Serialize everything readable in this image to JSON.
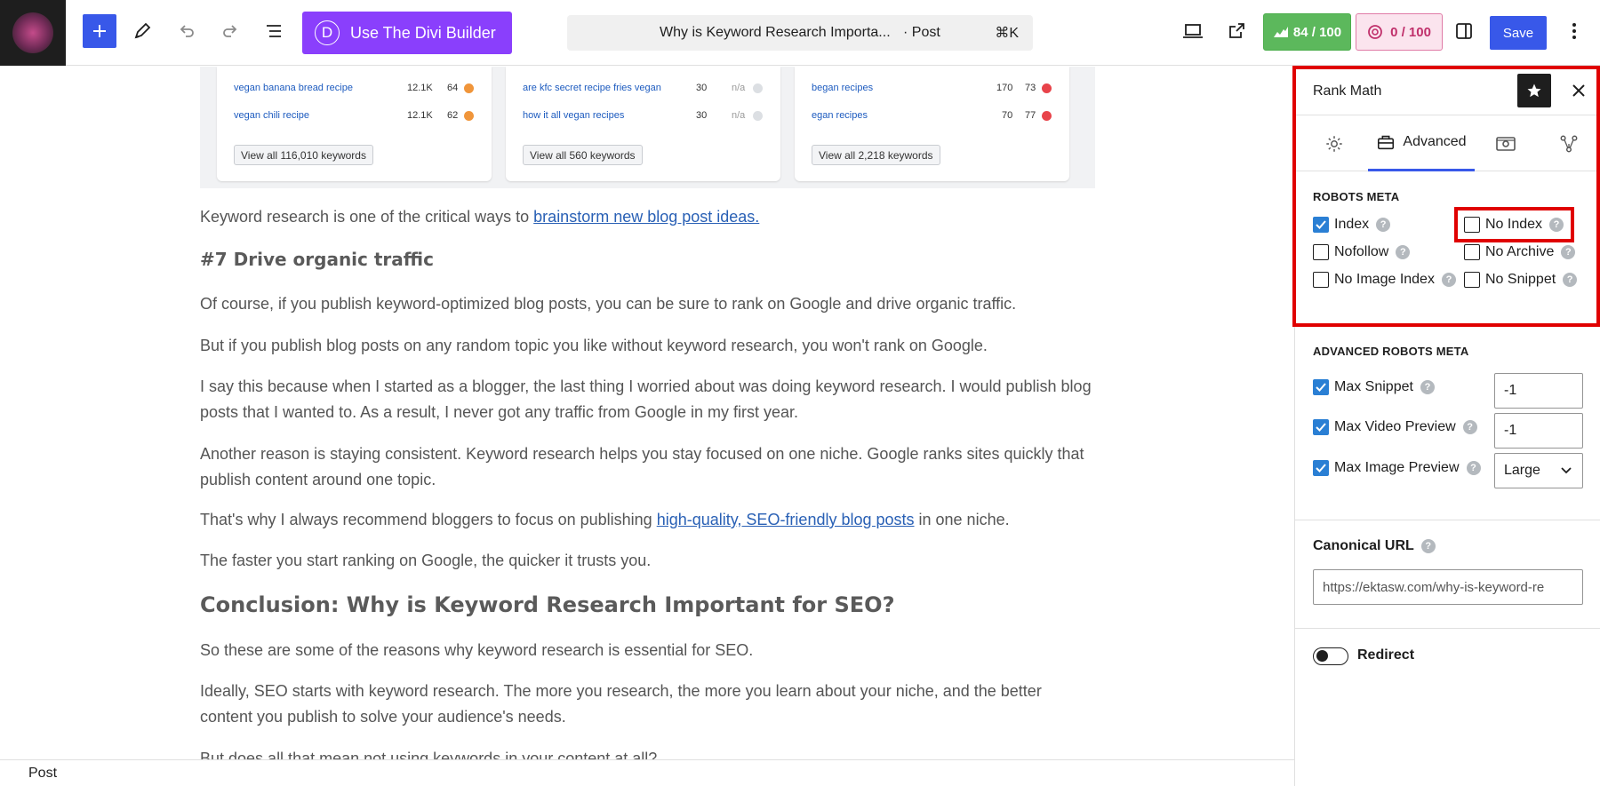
{
  "toolbar": {
    "divi_label": "Use The Divi Builder",
    "divi_logo_letter": "D",
    "command_title": "Why is Keyword Research Importa...",
    "command_type": "· Post",
    "command_shortcut": "⌘K",
    "seo_score": "84 / 100",
    "content_score": "0 / 100",
    "save_label": "Save"
  },
  "keyword_cards": [
    {
      "rows": [
        {
          "keyword": "vegan banana bread recipe",
          "volume": "12.1K",
          "kd": "64",
          "dot": "#f0953a"
        },
        {
          "keyword": "vegan chili recipe",
          "volume": "12.1K",
          "kd": "62",
          "dot": "#f0953a"
        }
      ],
      "view_all": "View all 116,010 keywords"
    },
    {
      "rows": [
        {
          "keyword": "are kfc secret recipe fries vegan",
          "volume": "30",
          "kd": "n/a",
          "dot": "#dcdfe3"
        },
        {
          "keyword": "how it all vegan recipes",
          "volume": "30",
          "kd": "n/a",
          "dot": "#dcdfe3"
        }
      ],
      "view_all": "View all 560 keywords"
    },
    {
      "rows": [
        {
          "keyword": "began recipes",
          "volume": "170",
          "kd": "73",
          "dot": "#e8434a"
        },
        {
          "keyword": "egan recipes",
          "volume": "70",
          "kd": "77",
          "dot": "#e8434a"
        }
      ],
      "view_all": "View all 2,218 keywords"
    }
  ],
  "content": {
    "p1_text": "Keyword research is one of the critical ways to ",
    "p1_link": "brainstorm new blog post ideas.",
    "h_drive": "#7 Drive organic traffic",
    "p2": "Of course, if you publish keyword-optimized blog posts, you can be sure to rank on Google and drive organic traffic.",
    "p3": "But if you publish blog posts on any random topic you like without keyword research, you won't rank on Google.",
    "p4": "I say this because when I started as a blogger, the last thing I worried about was doing keyword research. I would publish blog posts that I wanted to. As a result, I never got any traffic from Google in my first year.",
    "p5": "Another reason is staying consistent. Keyword research helps you stay focused on one niche. Google ranks sites quickly that publish content around one topic.",
    "p6_text": "That's why I always recommend bloggers to focus on publishing ",
    "p6_link": "high-quality, SEO-friendly blog posts",
    "p6_end": " in one niche.",
    "p7": "The faster you start ranking on Google, the quicker it trusts you.",
    "h_conclusion": "Conclusion: Why is Keyword Research Important for SEO?",
    "p8": "So these are some of the reasons why keyword research is essential for SEO.",
    "p9": "Ideally, SEO starts with keyword research. The more you research, the more you learn about your niche, and the better content you publish to solve your audience's needs.",
    "p10": "But does all that mean not using keywords in your content at all?"
  },
  "footer": {
    "label": "Post"
  },
  "sidebar": {
    "title": "Rank Math",
    "tab_advanced": "Advanced",
    "robots_title": "ROBOTS META",
    "robots": {
      "index": "Index",
      "no_index": "No Index",
      "nofollow": "Nofollow",
      "no_archive": "No Archive",
      "no_image_index": "No Image Index",
      "no_snippet": "No Snippet"
    },
    "adv_title": "ADVANCED ROBOTS META",
    "max_snippet": "Max Snippet",
    "max_snippet_value": "-1",
    "max_video": "Max Video Preview",
    "max_video_value": "-1",
    "max_image": "Max Image Preview",
    "max_image_value": "Large",
    "canonical_label": "Canonical URL",
    "canonical_value": "https://ektasw.com/why-is-keyword-re",
    "redirect_label": "Redirect",
    "help_glyph": "?"
  }
}
